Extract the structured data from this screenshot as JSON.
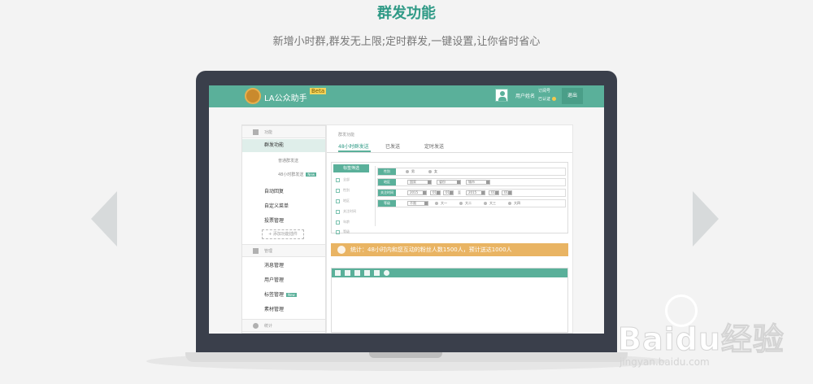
{
  "hero": {
    "title": "群发功能",
    "subtitle": "新增小时群,群发无上限;定时群发,一键设置,让你省时省心"
  },
  "header": {
    "logo_text": "LA公众助手",
    "beta": "Beta",
    "username": "用户姓名",
    "account_type": "订阅号",
    "account_status": "已认证",
    "logout": "退出"
  },
  "sidebar": {
    "sections": [
      {
        "label": "功能",
        "icon": "grid-icon"
      },
      {
        "label": "管理",
        "icon": "download-icon"
      },
      {
        "label": "统计",
        "icon": "pie-chart-icon"
      }
    ],
    "items_function": [
      "群发功能",
      "自动回复",
      "自定义菜单",
      "投票管理"
    ],
    "subitems": [
      "普通群发送",
      "48小时群发送"
    ],
    "new_badge": "New",
    "add_tag": "+ 添加功能插件",
    "items_manage": [
      "消息管理",
      "用户管理",
      "标签管理",
      "素材管理"
    ]
  },
  "main": {
    "breadcrumb": "群发功能",
    "tabs": [
      "48小时群发送",
      "已发送",
      "定时发送"
    ],
    "filter": {
      "head": "标签筛选",
      "list": [
        "全部",
        "性别",
        "地区",
        "关注时间",
        "年龄",
        "等级"
      ],
      "rows": [
        {
          "label": "性别",
          "options": [
            "男",
            "女"
          ]
        },
        {
          "label": "地区",
          "selects": [
            "国家",
            "省份",
            "城市"
          ]
        },
        {
          "label": "关注时间",
          "dates": [
            "2015",
            "01",
            "01",
            "2015",
            "01",
            "01"
          ],
          "to": "至"
        },
        {
          "label": "等级",
          "select": "不限",
          "options": [
            "大一",
            "大二",
            "大三",
            "大四"
          ]
        }
      ]
    },
    "stat_text": "统计：48小时内和您互动的粉丝人数1500人，预计送达1000人"
  },
  "watermark": {
    "brand": "Baidu经验",
    "url": "jingyan.baidu.com"
  }
}
